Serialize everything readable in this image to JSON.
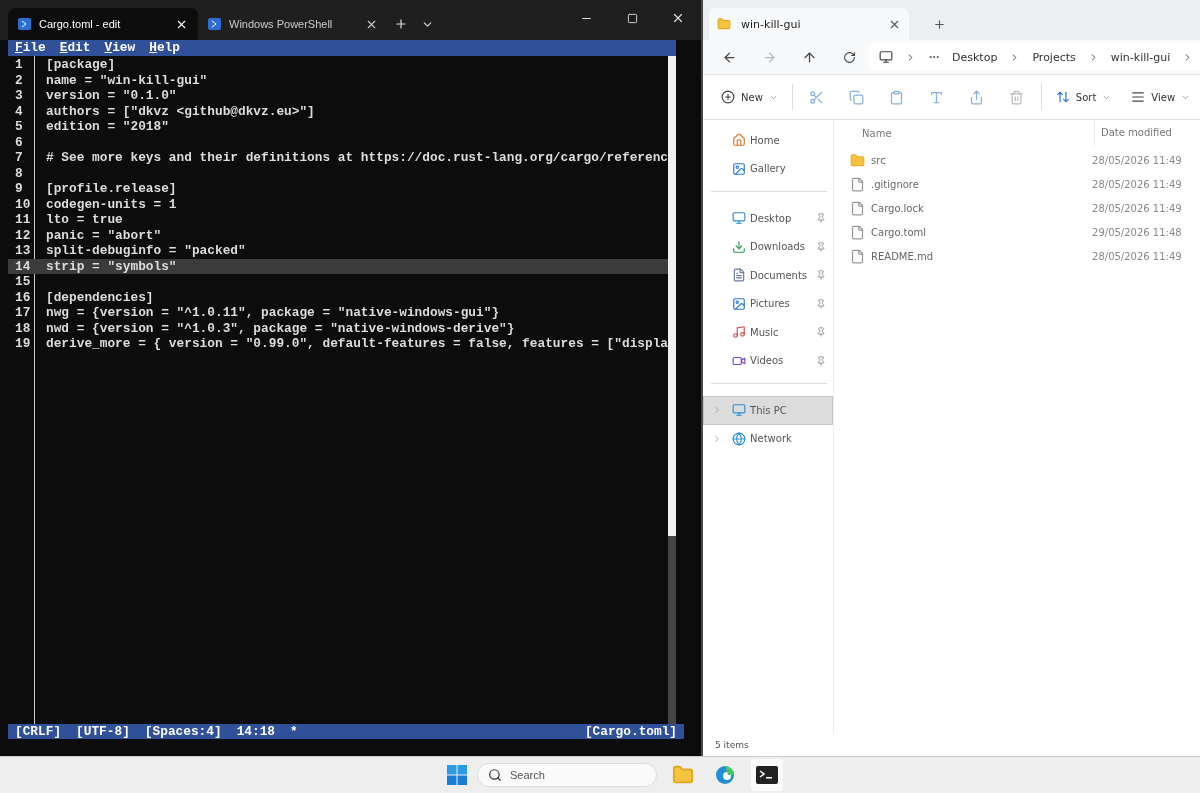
{
  "terminal": {
    "tabs": [
      {
        "title": "Cargo.toml - edit",
        "selected": true
      },
      {
        "title": "Windows PowerShell",
        "selected": false
      }
    ],
    "menu": [
      "File",
      "Edit",
      "View",
      "Help"
    ],
    "lines": [
      {
        "number": "1",
        "text": "[package]",
        "current": false
      },
      {
        "number": "2",
        "text": "name = \"win-kill-gui\"",
        "current": false
      },
      {
        "number": "3",
        "text": "version = \"0.1.0\"",
        "current": false
      },
      {
        "number": "4",
        "text": "authors = [\"dkvz <github@dkvz.eu>\"]",
        "current": false
      },
      {
        "number": "5",
        "text": "edition = \"2018\"",
        "current": false
      },
      {
        "number": "6",
        "current": false
      },
      {
        "number": "7",
        "text": "# See more keys and their definitions at https://doc.rust-lang.org/cargo/referenc",
        "current": false
      },
      {
        "number": "8",
        "current": false
      },
      {
        "number": "9",
        "text": "[profile.release]",
        "current": false
      },
      {
        "number": "10",
        "text": "codegen-units = 1",
        "current": false
      },
      {
        "number": "11",
        "text": "lto = true",
        "current": false
      },
      {
        "number": "12",
        "text": "panic = \"abort\"",
        "current": false
      },
      {
        "number": "13",
        "text": "split-debuginfo = \"packed\"",
        "current": false
      },
      {
        "number": "14",
        "text": "strip = \"symbols\"",
        "current": true
      },
      {
        "number": "15",
        "current": false
      },
      {
        "number": "16",
        "text": "[dependencies]",
        "current": false
      },
      {
        "number": "17",
        "text": "nwg = {version = \"^1.0.11\", package = \"native-windows-gui\"}",
        "current": false
      },
      {
        "number": "18",
        "text": "nwd = {version = \"^1.0.3\", package = \"native-windows-derive\"}",
        "current": false
      },
      {
        "number": "19",
        "text": "derive_more = { version = \"0.99.0\", default-features = false, features = [\"displa",
        "current": false
      }
    ],
    "status": [
      "[CRLF]",
      "[UTF-8]",
      "[Spaces:4]",
      "14:18",
      "*"
    ],
    "status_right": "[Cargo.toml]"
  },
  "explorer": {
    "tab": "win-kill-gui",
    "breadcrumb": [
      "Desktop",
      "Projects",
      "win-kill-gui"
    ],
    "commands": [
      {
        "label": "New",
        "kind": "new"
      },
      {
        "label": "Sort",
        "kind": "sort"
      },
      {
        "label": "View",
        "kind": "view"
      }
    ],
    "sidebar": {
      "top": [
        "Home",
        "Gallery"
      ],
      "pinned": [
        "Desktop",
        "Downloads",
        "Documents",
        "Pictures",
        "Music",
        "Videos"
      ],
      "tree": [
        {
          "label": "This PC",
          "selected": true
        },
        {
          "label": "Network",
          "selected": false
        }
      ]
    },
    "columns": [
      "Name",
      "Date modified"
    ],
    "files": [
      {
        "name": "src",
        "date": "28/05/2026 11:49",
        "kind": "folder"
      },
      {
        "name": ".gitignore",
        "date": "28/05/2026 11:49",
        "kind": "file"
      },
      {
        "name": "Cargo.lock",
        "date": "28/05/2026 11:49",
        "kind": "file"
      },
      {
        "name": "Cargo.toml",
        "date": "29/05/2026 11:48",
        "kind": "file"
      },
      {
        "name": "README.md",
        "date": "28/05/2026 11:49",
        "kind": "file"
      }
    ],
    "status": "5 items"
  },
  "taskbar": {
    "search": {
      "placeholder": "Search"
    }
  }
}
